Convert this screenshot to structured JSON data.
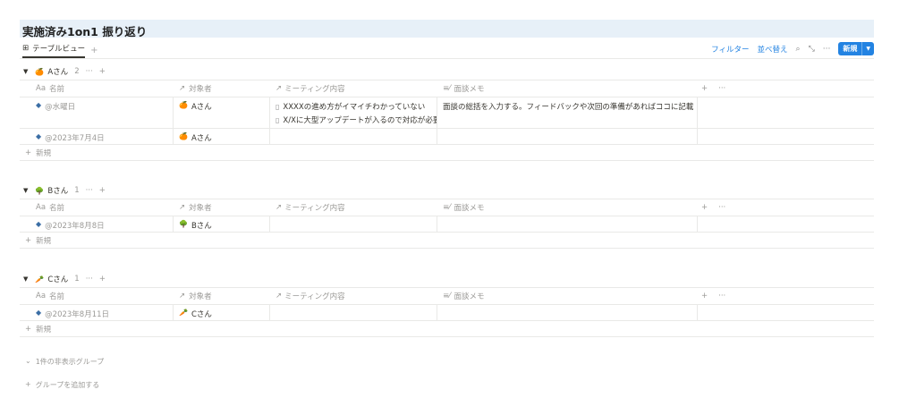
{
  "page": {
    "title": "実施済み1on1 振り返り"
  },
  "tabs": [
    {
      "label": "テーブルビュー",
      "icon": "table-icon"
    }
  ],
  "toolbar": {
    "filter": "フィルター",
    "sort": "並べ替え",
    "new": "新規"
  },
  "columns": {
    "name": "名前",
    "target": "対象者",
    "meeting": "ミーティング内容",
    "memo": "面談メモ",
    "name_prefix": "Aa",
    "target_icon": "arrow-relation-icon",
    "memo_icon": "text-lines-icon"
  },
  "groups": [
    {
      "name": "Aさん",
      "emoji": "🍊",
      "count": "2",
      "rows": [
        {
          "name": "@水曜日",
          "target": "Aさん",
          "target_emoji": "🍊",
          "meeting": [
            "XXXXの進め方がイマイチわかっていない",
            "X/Xに大型アップデートが入るので対応が必要"
          ],
          "memo": "面談の総括を入力する。フィードバックや次回の準備があればココに記載"
        },
        {
          "name": "@2023年7月4日",
          "target": "Aさん",
          "target_emoji": "🍊",
          "meeting": [],
          "memo": ""
        }
      ],
      "add_label": "新規"
    },
    {
      "name": "Bさん",
      "emoji": "🌳",
      "count": "1",
      "rows": [
        {
          "name": "@2023年8月8日",
          "target": "Bさん",
          "target_emoji": "🌳",
          "meeting": [],
          "memo": ""
        }
      ],
      "add_label": "新規"
    },
    {
      "name": "Cさん",
      "emoji": "🥕",
      "count": "1",
      "rows": [
        {
          "name": "@2023年8月11日",
          "target": "Cさん",
          "target_emoji": "🥕",
          "meeting": [],
          "memo": ""
        }
      ],
      "add_label": "新規"
    }
  ],
  "footer": {
    "hidden_groups": "1件の非表示グループ",
    "add_group": "グループを追加する"
  },
  "colors": {
    "accent": "#2383e2",
    "title_bg": "#e7f0f8",
    "muted": "#9b9a97"
  }
}
